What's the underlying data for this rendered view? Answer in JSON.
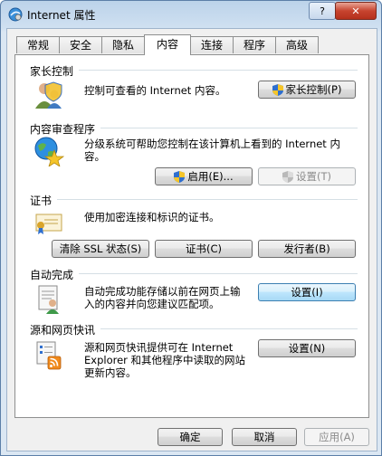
{
  "window": {
    "title": "Internet 属性",
    "help_glyph": "?",
    "close_glyph": "✕"
  },
  "tabs": [
    {
      "label": "常规"
    },
    {
      "label": "安全"
    },
    {
      "label": "隐私"
    },
    {
      "label": "内容",
      "active": true
    },
    {
      "label": "连接"
    },
    {
      "label": "程序"
    },
    {
      "label": "高级"
    }
  ],
  "parental": {
    "title": "家长控制",
    "desc": "控制可查看的 Internet 内容。",
    "button": "家长控制(P)"
  },
  "advisor": {
    "title": "内容审查程序",
    "desc_line1": "分级系统可帮助您控制在该计算机上看到的 Internet 内",
    "desc_line2": "容。",
    "enable_button": "启用(E)...",
    "settings_button": "设置(T)"
  },
  "certificates": {
    "title": "证书",
    "desc": "使用加密连接和标识的证书。",
    "clear_ssl_button": "清除 SSL 状态(S)",
    "certificates_button": "证书(C)",
    "publishers_button": "发行者(B)"
  },
  "autocomplete": {
    "title": "自动完成",
    "desc_line1": "自动完成功能存储以前在网页上输",
    "desc_line2": "入的内容并向您建议匹配项。",
    "settings_button": "设置(I)"
  },
  "feeds": {
    "title": "源和网页快讯",
    "desc_line1": "源和网页快讯提供可在 Internet",
    "desc_line2": "Explorer 和其他程序中读取的网站",
    "desc_line3": "更新内容。",
    "settings_button": "设置(N)"
  },
  "dialog": {
    "ok": "确定",
    "cancel": "取消",
    "apply": "应用(A)"
  },
  "colors": {
    "accent_border": "#3c7fb1",
    "title_bar": "#bcd3ea",
    "close_red": "#c7442f"
  }
}
